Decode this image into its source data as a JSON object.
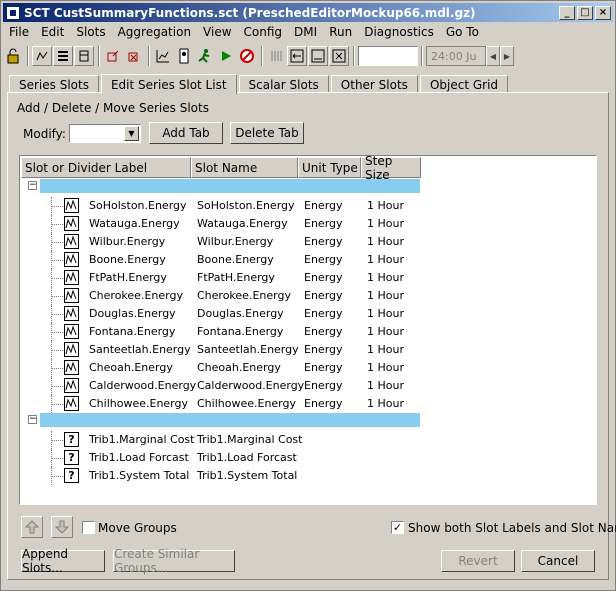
{
  "window": {
    "title": "SCT CustSummaryFunctions.sct (PreschedEditorMockup66.mdl.gz)"
  },
  "menu": [
    "File",
    "Edit",
    "Slots",
    "Aggregation",
    "View",
    "Config",
    "DMI",
    "Run",
    "Diagnostics",
    "Go To"
  ],
  "toolbar": {
    "time_value": "24:00 Ju",
    "icons": [
      "lock-icon",
      "series-slot-icon",
      "list-icon",
      "columns-icon",
      "open-slot-icon",
      "close-slot-icon",
      "plot-icon",
      "config-icon",
      "run-man-icon",
      "play-icon",
      "stop-icon",
      "bars-icon",
      "align-left-icon",
      "align-bottom-icon",
      "fit-icon"
    ]
  },
  "tabs": [
    {
      "label": "Series Slots",
      "active": false
    },
    {
      "label": "Edit Series Slot List",
      "active": true
    },
    {
      "label": "Scalar Slots",
      "active": false
    },
    {
      "label": "Other Slots",
      "active": false
    },
    {
      "label": "Object Grid",
      "active": false
    }
  ],
  "editor": {
    "heading": "Add / Delete / Move Series Slots",
    "modify_label": "Modify:",
    "modify_value": "",
    "add_tab": "Add Tab",
    "delete_tab": "Delete Tab"
  },
  "table": {
    "columns": [
      "Slot or Divider Label",
      "Slot Name",
      "Unit Type",
      "Step Size"
    ],
    "groups": [
      {
        "rows": [
          {
            "label": "SoHolston.Energy",
            "name": "SoHolston.Energy",
            "unit": "Energy",
            "step": "1 Hour",
            "icon": "series-icon"
          },
          {
            "label": "Watauga.Energy",
            "name": "Watauga.Energy",
            "unit": "Energy",
            "step": "1 Hour",
            "icon": "series-icon"
          },
          {
            "label": "Wilbur.Energy",
            "name": "Wilbur.Energy",
            "unit": "Energy",
            "step": "1 Hour",
            "icon": "series-icon"
          },
          {
            "label": "Boone.Energy",
            "name": "Boone.Energy",
            "unit": "Energy",
            "step": "1 Hour",
            "icon": "series-icon"
          },
          {
            "label": "FtPatH.Energy",
            "name": "FtPatH.Energy",
            "unit": "Energy",
            "step": "1 Hour",
            "icon": "series-icon"
          },
          {
            "label": "Cherokee.Energy",
            "name": "Cherokee.Energy",
            "unit": "Energy",
            "step": "1 Hour",
            "icon": "series-icon"
          },
          {
            "label": "Douglas.Energy",
            "name": "Douglas.Energy",
            "unit": "Energy",
            "step": "1 Hour",
            "icon": "series-icon"
          },
          {
            "label": "Fontana.Energy",
            "name": "Fontana.Energy",
            "unit": "Energy",
            "step": "1 Hour",
            "icon": "series-icon"
          },
          {
            "label": "Santeetlah.Energy",
            "name": "Santeetlah.Energy",
            "unit": "Energy",
            "step": "1 Hour",
            "icon": "series-icon"
          },
          {
            "label": "Cheoah.Energy",
            "name": "Cheoah.Energy",
            "unit": "Energy",
            "step": "1 Hour",
            "icon": "series-icon"
          },
          {
            "label": "Calderwood.Energy",
            "name": "Calderwood.Energy",
            "unit": "Energy",
            "step": "1 Hour",
            "icon": "series-icon"
          },
          {
            "label": "Chilhowee.Energy",
            "name": "Chilhowee.Energy",
            "unit": "Energy",
            "step": "1 Hour",
            "icon": "series-icon"
          }
        ]
      },
      {
        "rows": [
          {
            "label": "Trib1.Marginal Cost",
            "name": "Trib1.Marginal Cost",
            "unit": "",
            "step": "",
            "icon": "unknown-icon"
          },
          {
            "label": "Trib1.Load Forcast",
            "name": "Trib1.Load Forcast",
            "unit": "",
            "step": "",
            "icon": "unknown-icon"
          },
          {
            "label": "Trib1.System Total",
            "name": "Trib1.System Total",
            "unit": "",
            "step": "",
            "icon": "unknown-icon"
          }
        ]
      }
    ]
  },
  "footer": {
    "move_groups": "Move Groups",
    "move_groups_checked": false,
    "show_both": "Show both Slot Labels and Slot Names",
    "show_both_checked": true,
    "append_slots": "Append Slots...",
    "create_similar": "Create Similar Groups...",
    "revert": "Revert",
    "cancel": "Cancel"
  }
}
